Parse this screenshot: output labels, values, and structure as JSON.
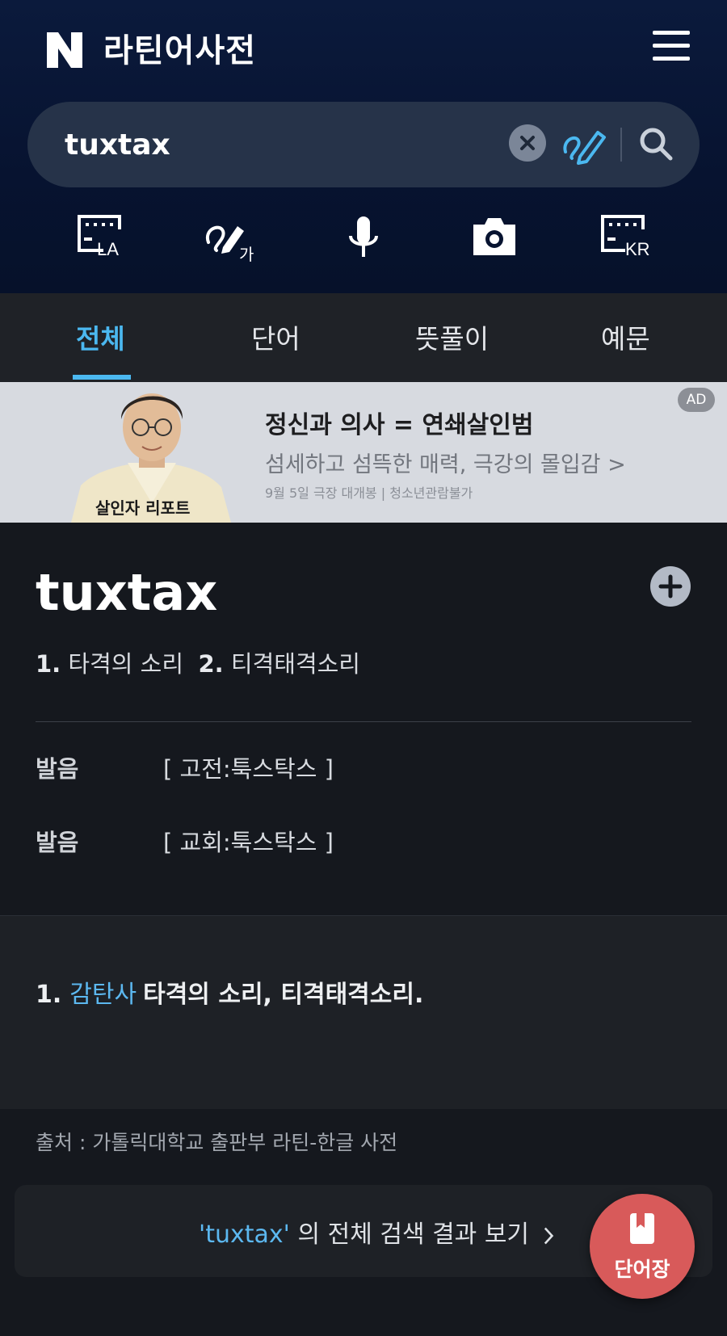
{
  "header": {
    "logo": "N",
    "title": "라틴어사전",
    "menu_icon": "hamburger-menu-icon"
  },
  "search": {
    "query": "tuxtax",
    "clear_icon": "clear-icon",
    "handwrite_icon": "handwriting-icon",
    "search_icon": "search-icon"
  },
  "tools": [
    {
      "name": "latin-keyboard",
      "label": "LA"
    },
    {
      "name": "handwriting-input",
      "label": "가"
    },
    {
      "name": "voice-input"
    },
    {
      "name": "camera-input"
    },
    {
      "name": "korean-keyboard",
      "label": "KR"
    }
  ],
  "tabs": [
    {
      "label": "전체",
      "active": true
    },
    {
      "label": "단어",
      "active": false
    },
    {
      "label": "뜻풀이",
      "active": false
    },
    {
      "label": "예문",
      "active": false
    }
  ],
  "ad": {
    "badge": "AD",
    "caption": "살인자 리포트",
    "title": "정신과 의사 = 연쇄살인범",
    "subtitle": "섬세하고 섬뜩한 매력, 극강의 몰입감 >",
    "small": "9월 5일 극장 대개봉 | 청소년관람불가"
  },
  "entry": {
    "word": "tuxtax",
    "summary": [
      {
        "num": "1.",
        "text": "타격의 소리"
      },
      {
        "num": "2.",
        "text": "티격태격소리"
      }
    ],
    "pronunciations": [
      {
        "label": "발음",
        "value": "[ 고전:툭스탁스 ]"
      },
      {
        "label": "발음",
        "value": "[ 교회:툭스탁스 ]"
      }
    ]
  },
  "meaning": {
    "num": "1.",
    "pos": "감탄사",
    "text": "타격의 소리, 티격태격소리."
  },
  "source": "출처 : 가톨릭대학교 출판부 라틴-한글 사전",
  "full_result": {
    "query": "'tuxtax'",
    "text": " 의 전체 검색 결과 보기"
  },
  "vocab_button": {
    "label": "단어장"
  },
  "colors": {
    "accent": "#4bb8f0",
    "header_bg": "#0b1a3c",
    "vocab_button": "#d85a5a"
  }
}
